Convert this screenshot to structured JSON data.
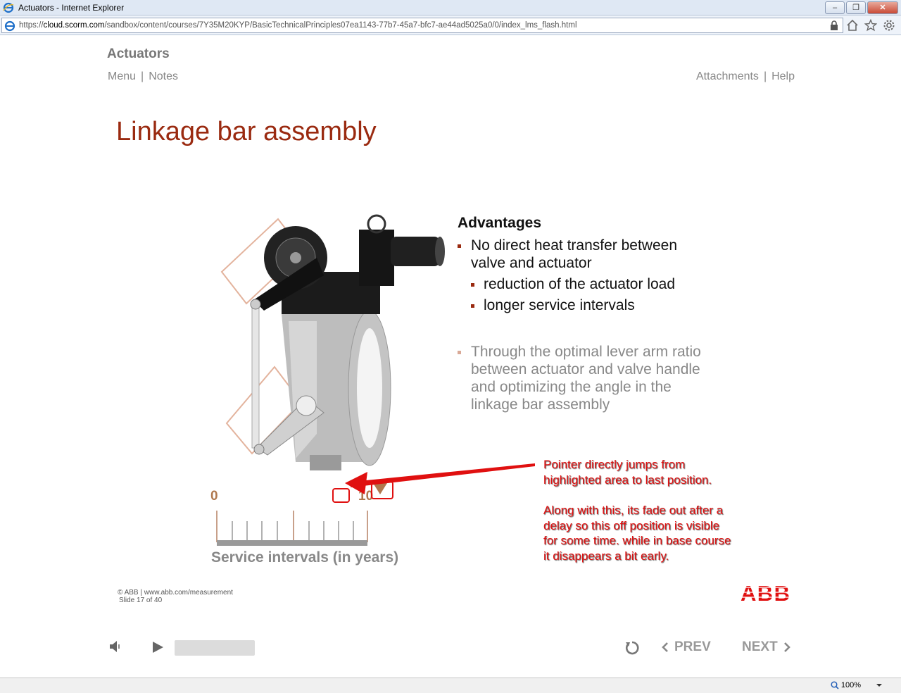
{
  "window": {
    "title": "Actuators - Internet Explorer",
    "controls": [
      "minimize",
      "restore",
      "close"
    ]
  },
  "address": {
    "scheme": "https://",
    "host": "cloud.scorm.com",
    "path": "/sandbox/content/courses/7Y35M20KYP/BasicTechnicalPrinciples07ea1143-77b7-45a7-bfc7-ae44ad5025a0/0/index_lms_flash.html"
  },
  "course": {
    "title": "Actuators",
    "nav_left": [
      "Menu",
      "Notes"
    ],
    "nav_right": [
      "Attachments",
      "Help"
    ]
  },
  "slide": {
    "title": "Linkage bar assembly",
    "advantages_heading": "Advantages",
    "bullet1_line1": "No direct heat transfer between",
    "bullet1_line2": "valve and actuator",
    "sub1": "reduction of the actuator load",
    "sub2": "longer service intervals",
    "bullet2_line1": "Through the optimal lever arm ratio",
    "bullet2_line2": "between actuator and valve handle",
    "bullet2_line3": "and optimizing the angle in the",
    "bullet2_line4": "linkage bar assembly",
    "scale_min": "0",
    "scale_max": "10",
    "scale_label": "Service intervals (in years)"
  },
  "annotation": {
    "line1": "Pointer directly jumps from",
    "line2": "highlighted area to last position.",
    "line3": "Along with this, its fade out after a",
    "line4": "delay so this off position is visible",
    "line5": "for some time. while in base course",
    "line6": "it disappears a bit early.",
    "color": "#e01010"
  },
  "footer": {
    "copyright": "© ABB | www.abb.com/measurement",
    "slide_counter": "Slide 17 of 40",
    "logo_text": "ABB"
  },
  "player": {
    "prev_label": "PREV",
    "next_label": "NEXT"
  },
  "statusbar": {
    "zoom": "100%"
  },
  "colors": {
    "title_red": "#9a2a10",
    "bullet_red": "#9a2a10",
    "scale_orange": "#b0784e"
  }
}
